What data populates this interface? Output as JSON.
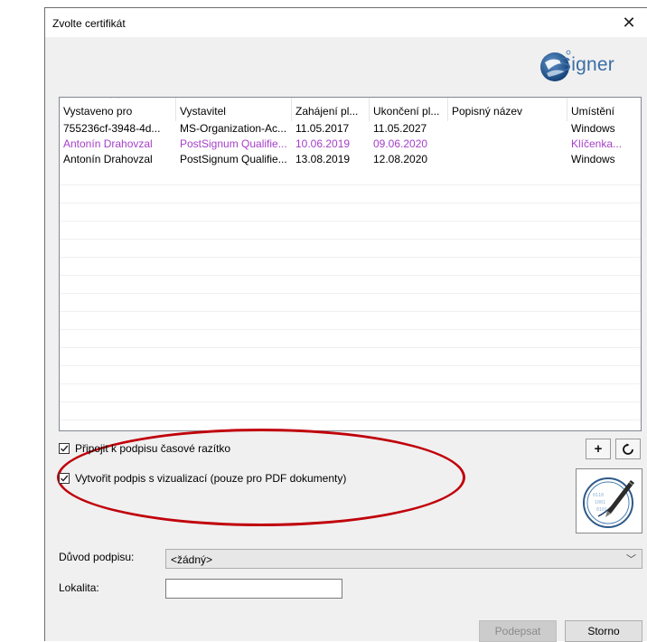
{
  "window": {
    "title": "Zvolte certifikát",
    "close_glyph": "✕"
  },
  "logo": {
    "text": "Signer",
    "icon": "signer-logo-icon",
    "brand_color": "#3a6ea5"
  },
  "certificates": {
    "columns": [
      "Vystaveno pro",
      "Vystavitel",
      "Zahájení pl...",
      "Ukončení pl...",
      "Popisný název",
      "Umístění"
    ],
    "rows": [
      {
        "cells": [
          "755236cf-3948-4d...",
          "MS-Organization-Ac...",
          "11.05.2017",
          "11.05.2027",
          "",
          "Windows"
        ],
        "highlight": false
      },
      {
        "cells": [
          "Antonín Drahovzal",
          "PostSignum Qualifie...",
          "10.06.2019",
          "09.06.2020",
          "",
          "Klíčenka..."
        ],
        "highlight": true
      },
      {
        "cells": [
          "Antonín Drahovzal",
          "PostSignum Qualifie...",
          "13.08.2019",
          "12.08.2020",
          "",
          "Windows"
        ],
        "highlight": false
      }
    ],
    "highlight_color": "#a53fc8"
  },
  "options": {
    "timestamp": {
      "label": "Připojit k podpisu časové razítko",
      "checked": true
    },
    "visualization": {
      "label": "Vytvořit podpis s vizualizací (pouze pro PDF dokumenty)",
      "checked": true
    }
  },
  "toolbar": {
    "add_label": "+",
    "refresh_icon": "refresh-icon"
  },
  "form": {
    "reason_label": "Důvod podpisu:",
    "reason_value": "<žádný>",
    "location_label": "Lokalita:",
    "location_value": ""
  },
  "buttons": {
    "sign": "Podepsat",
    "cancel": "Storno"
  },
  "annotation_color": "#c0000a"
}
